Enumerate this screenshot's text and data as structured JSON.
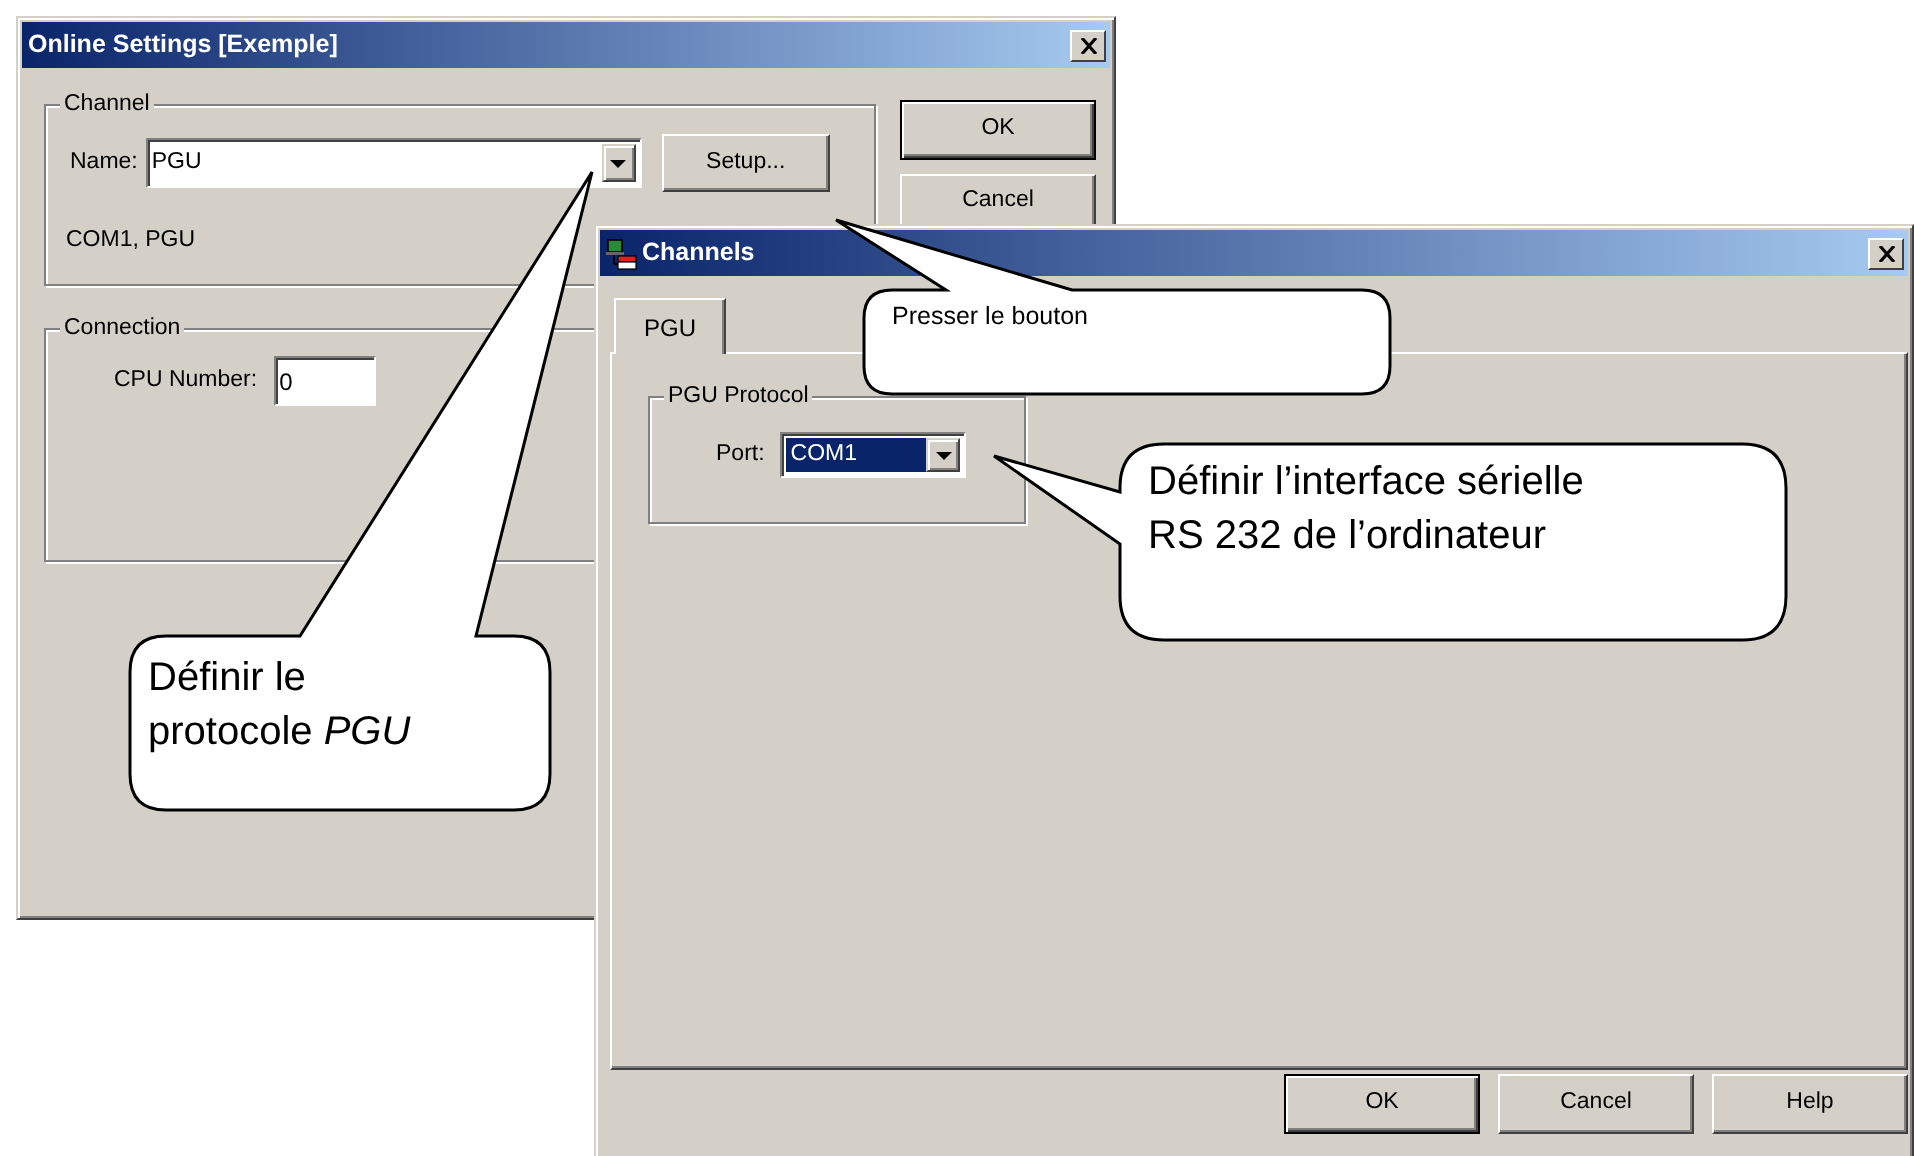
{
  "online_settings": {
    "title": "Online Settings [Exemple]",
    "channel_group": {
      "label": "Channel",
      "name_label": "Name:",
      "name_value": "PGU",
      "setup_button": "Setup...",
      "summary": "COM1, PGU"
    },
    "connection_group": {
      "label": "Connection",
      "cpu_label": "CPU Number:",
      "cpu_value": "0"
    },
    "buttons": [
      {
        "label": "OK",
        "default": true
      },
      {
        "label": "Cancel",
        "default": false
      }
    ]
  },
  "channels": {
    "title": "Channels",
    "tabs": [
      {
        "label": "PGU",
        "selected": true
      }
    ],
    "protocol_group": {
      "label": "PGU Protocol",
      "port_label": "Port:",
      "port_value": "COM1"
    },
    "buttons": [
      {
        "label": "OK",
        "default": true
      },
      {
        "label": "Cancel",
        "default": false
      },
      {
        "label": "Help",
        "default": false
      }
    ]
  },
  "callouts": [
    {
      "text": "Presser le bouton",
      "kind": "hint"
    },
    {
      "text": "Définir l’interface sérielle RS 232 de l’ordinateur",
      "kind": "explanation"
    },
    {
      "text": "Définir le protocole *PGU*",
      "kind": "explanation"
    }
  ]
}
